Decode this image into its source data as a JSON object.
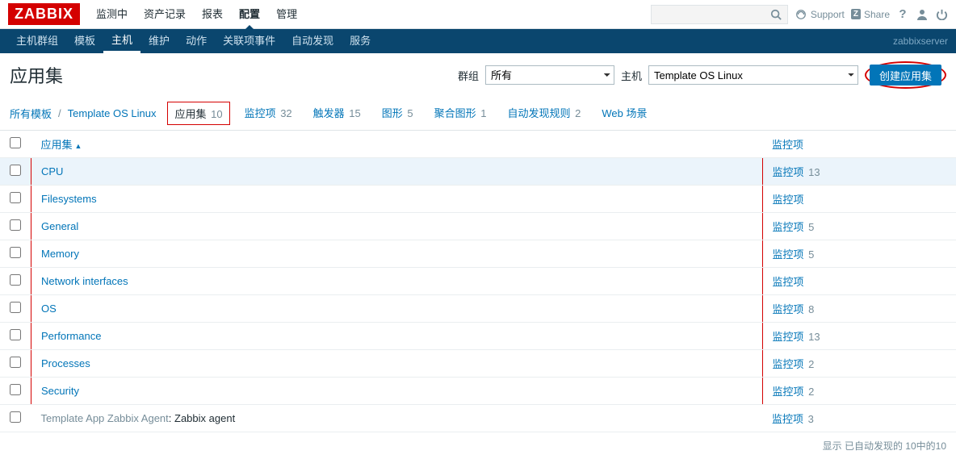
{
  "brand": "ZABBIX",
  "topnav": [
    "监测中",
    "资产记录",
    "报表",
    "配置",
    "管理"
  ],
  "topnav_active": 3,
  "support": "Support",
  "share": "Share",
  "subnav": [
    "主机群组",
    "模板",
    "主机",
    "维护",
    "动作",
    "关联项事件",
    "自动发现",
    "服务"
  ],
  "subnav_active": 2,
  "server": "zabbixserver",
  "page_title": "应用集",
  "filters": {
    "group_label": "群组",
    "group_value": "所有",
    "host_label": "主机",
    "host_value": "Template OS Linux"
  },
  "create_btn": "创建应用集",
  "breadcrumb": {
    "root": "所有模板",
    "template": "Template OS Linux"
  },
  "tabs": [
    {
      "label": "应用集",
      "count": "10",
      "active": true
    },
    {
      "label": "监控项",
      "count": "32"
    },
    {
      "label": "触发器",
      "count": "15"
    },
    {
      "label": "图形",
      "count": "5"
    },
    {
      "label": "聚合图形",
      "count": "1"
    },
    {
      "label": "自动发现规则",
      "count": "2"
    },
    {
      "label": "Web 场景",
      "count": ""
    }
  ],
  "columns": {
    "name": "应用集",
    "items": "监控项"
  },
  "rows": [
    {
      "name": "CPU",
      "items_label": "监控项",
      "count": "13",
      "hl": true
    },
    {
      "name": "Filesystems",
      "items_label": "监控项",
      "count": ""
    },
    {
      "name": "General",
      "items_label": "监控项",
      "count": "5"
    },
    {
      "name": "Memory",
      "items_label": "监控项",
      "count": "5"
    },
    {
      "name": "Network interfaces",
      "items_label": "监控项",
      "count": ""
    },
    {
      "name": "OS",
      "items_label": "监控项",
      "count": "8"
    },
    {
      "name": "Performance",
      "items_label": "监控项",
      "count": "13"
    },
    {
      "name": "Processes",
      "items_label": "监控项",
      "count": "2"
    },
    {
      "name": "Security",
      "items_label": "监控项",
      "count": "2"
    }
  ],
  "extra_row": {
    "prefix": "Template App Zabbix Agent",
    "name": "Zabbix agent",
    "items_label": "监控项",
    "count": "3"
  },
  "footer": "显示 已自动发现的 10中的10"
}
